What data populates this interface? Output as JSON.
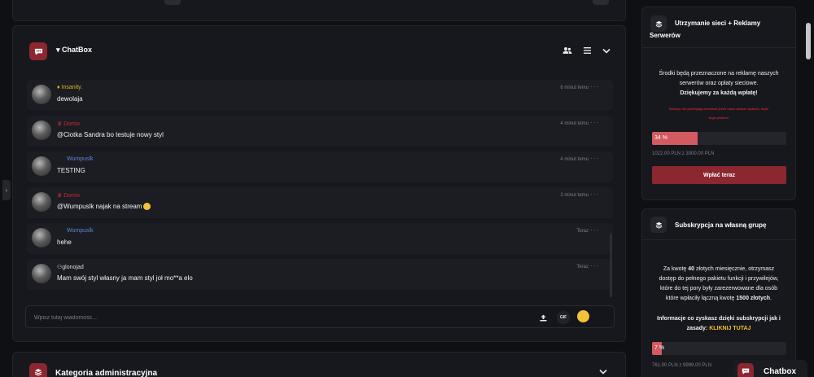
{
  "chatbox": {
    "title": "▾ ChatBox",
    "input_placeholder": "Wpisz tutaj wiadomość...",
    "gif_label": "GIF",
    "messages": [
      {
        "user": "Insanity.",
        "badge": "gem",
        "color": "#e3b020",
        "text": "dewolaja",
        "time": "6 minut temu"
      },
      {
        "user": "Domix",
        "badge": "crown",
        "color": "#d0272f",
        "text": "@Ciotka Sandra bo testuje nowy styl",
        "time": "4 minut temu"
      },
      {
        "user": "Wumpuslk",
        "badge": "none",
        "color": "#5a86d8",
        "text": "TESTING",
        "time": "4 minut temu"
      },
      {
        "user": "Domix",
        "badge": "crown",
        "color": "#d0272f",
        "text": "@Wumpuslk najak na stream",
        "time": "3 minut temu"
      },
      {
        "user": "Wumpuslk",
        "badge": "none",
        "color": "#5a86d8",
        "text": "hehe",
        "time": "Teraz"
      },
      {
        "user": "glonojad",
        "badge": "user",
        "color": "#dcdcdc",
        "text": "Mam swój styl własny ja mam styl joł mo**a elo",
        "time": "Teraz"
      }
    ]
  },
  "category": {
    "title": "Kategoria administracyjna"
  },
  "sidebar": {
    "card1": {
      "title_line1": "Utrzymanie sieci + Reklamy",
      "title_line2": "Serwerów",
      "desc_line1": "Środki będą przeznaczone na reklamę naszych",
      "desc_line2": "serwerów oraz opłaty sieciowe.",
      "thanks": "Dziękujemy za każdą wpłatę!",
      "warn_line1": "Dotacje nie podlegają zwrotowi jeżeli masz zamiar wpłacić, bądź",
      "warn_line2": "tego pewien!",
      "progress_percent": 34,
      "progress_label": "34 %",
      "amount": "1022.00 PLN z 3000.00 PLN",
      "button": "Wpłać teraz"
    },
    "card2": {
      "title": "Subskrypcja na własną grupę",
      "desc_l1_a": "Za kwotę ",
      "desc_l1_b": "40",
      "desc_l1_c": " złotych miesięcznie, otrzymasz",
      "desc_l2": "dostęp do pełnego pakietu funkcji i przywilejów,",
      "desc_l3": "które do tej pory były zarezerwowane dla osób",
      "desc_l4_a": "które wpłaciły łączną kwotę ",
      "desc_l4_b": "1500 złotych",
      "desc_l4_c": ".",
      "info_line1": "Informacje co zyskasz dzięki subskrypcji jak i",
      "info_line2": "zasady: ",
      "link": "KLIKNIJ TUTAJ",
      "progress_percent": 7,
      "progress_label": "7 %",
      "amount": "761.00 PLN z 9999.00 PLN"
    }
  },
  "floating": {
    "label": "Chatbox"
  },
  "colors": {
    "accent": "#8c2630",
    "progress": "#d25a60",
    "panel": "#17181d",
    "bg": "#0f1014",
    "gold": "#e3b020"
  }
}
